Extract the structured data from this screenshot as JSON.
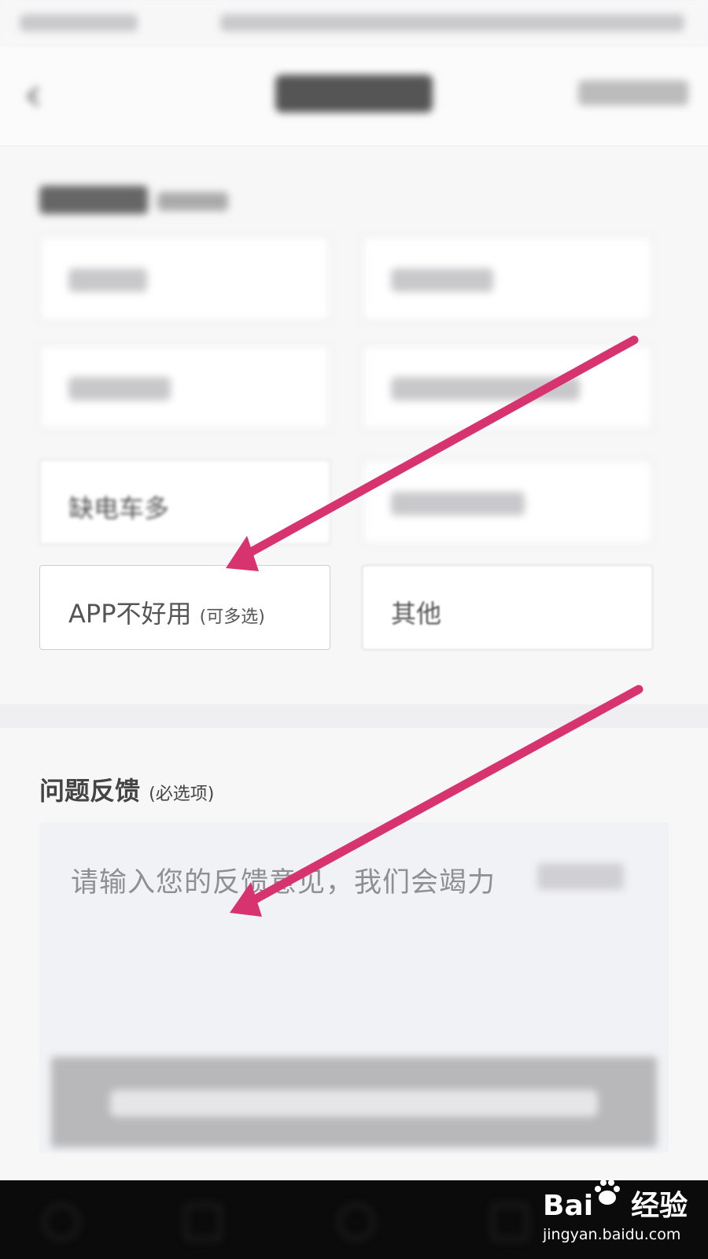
{
  "options": {
    "shortage": "缺电车多",
    "app_bad": "APP不好用",
    "app_bad_hint": "(可多选)",
    "other": "其他"
  },
  "feedback": {
    "title": "问题反馈",
    "required": "(必选项)",
    "placeholder": "请输入您的反馈意见，我们会竭力"
  },
  "watermark": {
    "logo_left": "Bai",
    "logo_right": "经验",
    "url": "jingyan.baidu.com"
  },
  "colors": {
    "arrow": "#d6336f",
    "placeholder": "#8e8e93",
    "textarea_bg": "#f1f2f5"
  }
}
